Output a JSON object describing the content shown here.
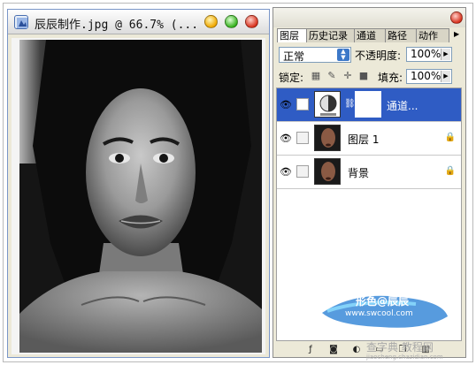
{
  "document": {
    "title": "辰辰制作.jpg @ 66.7% (..."
  },
  "layers_panel": {
    "tabs": [
      "图层",
      "历史记录",
      "通道",
      "路径",
      "动作"
    ],
    "blend_mode": "正常",
    "opacity_label": "不透明度:",
    "opacity_value": "100%",
    "lock_label": "锁定:",
    "fill_label": "填充:",
    "fill_value": "100%",
    "layers": [
      {
        "name": "通道...",
        "selected": true
      },
      {
        "name": "图层 1",
        "selected": false
      },
      {
        "name": "背景",
        "selected": false
      }
    ]
  },
  "watermark": {
    "stamp_text": "形色@辰辰",
    "stamp_url": "www.swcool.com",
    "site_line1": "查字典 教程网",
    "site_line2": "jiaocheng.chazidian.com"
  },
  "colors": {
    "selection": "#2f5cc4",
    "panel_bg": "#ece9d8",
    "stamp_blue": "#3a8ad8"
  }
}
